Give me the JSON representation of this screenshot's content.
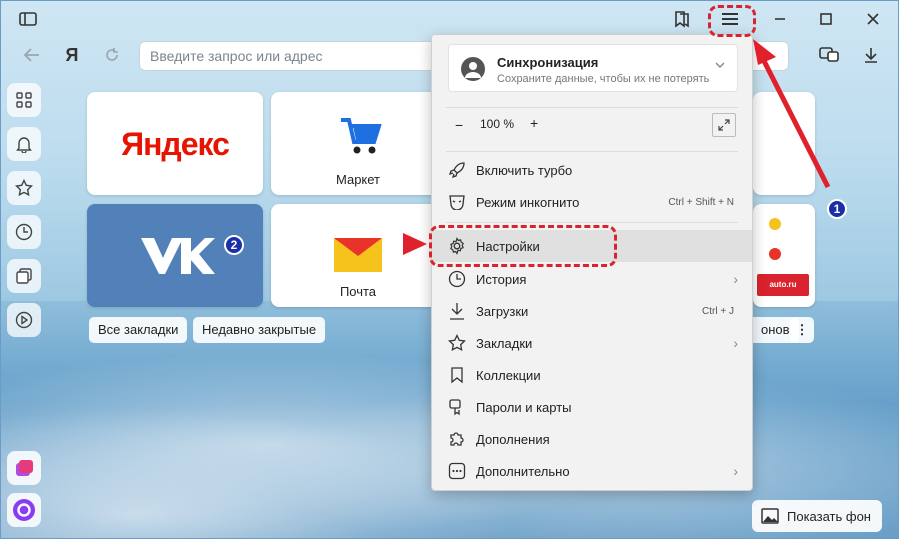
{
  "address_bar": {
    "placeholder": "Введите запрос или адрес",
    "logo_letter": "Я"
  },
  "tiles": [
    {
      "name": "yandex",
      "logo_text": "Яндекс",
      "label": ""
    },
    {
      "name": "market",
      "logo_text": "",
      "label": "Маркет"
    },
    {
      "name": "vk",
      "logo_text": "VK",
      "label": ""
    },
    {
      "name": "pochta",
      "logo_text": "",
      "label": "Почта"
    }
  ],
  "partial_tile": {
    "auto_label": "auto.ru"
  },
  "bottom_chips": {
    "bookmarks": "Все закладки",
    "recent": "Недавно закрытые",
    "partial": "онов"
  },
  "show_background": {
    "label": "Показать фон"
  },
  "menu": {
    "sync": {
      "title": "Синхронизация",
      "subtitle": "Сохраните данные, чтобы их не потерять"
    },
    "zoom": {
      "minus": "−",
      "value": "100 %",
      "plus": "+"
    },
    "items": [
      {
        "label": "Включить турбо",
        "shortcut": "",
        "submenu": false,
        "icon": "rocket-icon"
      },
      {
        "label": "Режим инкогнито",
        "shortcut": "Ctrl + Shift + N",
        "submenu": false,
        "icon": "incognito-icon"
      },
      {
        "label": "Настройки",
        "shortcut": "",
        "submenu": false,
        "icon": "gear-icon"
      },
      {
        "label": "История",
        "shortcut": "",
        "submenu": true,
        "icon": "clock-icon"
      },
      {
        "label": "Загрузки",
        "shortcut": "Ctrl + J",
        "submenu": false,
        "icon": "download-icon"
      },
      {
        "label": "Закладки",
        "shortcut": "",
        "submenu": true,
        "icon": "star-icon"
      },
      {
        "label": "Коллекции",
        "shortcut": "",
        "submenu": false,
        "icon": "collections-icon"
      },
      {
        "label": "Пароли и карты",
        "shortcut": "",
        "submenu": false,
        "icon": "key-icon"
      },
      {
        "label": "Дополнения",
        "shortcut": "",
        "submenu": false,
        "icon": "puzzle-icon"
      },
      {
        "label": "Дополнительно",
        "shortcut": "",
        "submenu": true,
        "icon": "more-icon"
      }
    ]
  },
  "annotations": {
    "badge1": "1",
    "badge2": "2"
  },
  "colors": {
    "annotation_red": "#d9232e",
    "badge_blue": "#1b2fa8",
    "vk_blue": "#5181b8",
    "yandex_red": "#e61400"
  }
}
